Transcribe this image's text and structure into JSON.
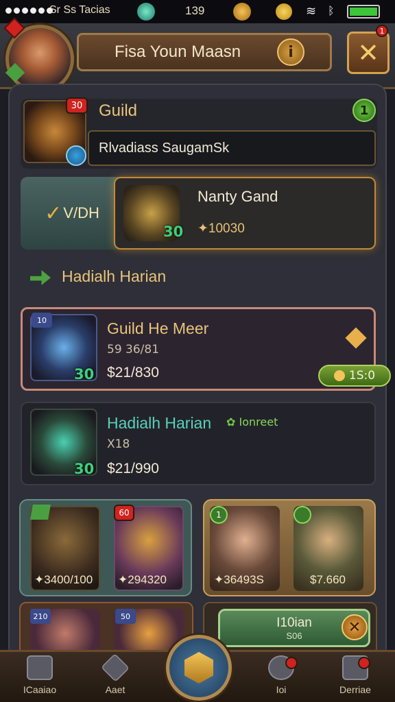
{
  "status": {
    "carrier": "Sr Ss Tacias",
    "gems": "139",
    "colors": {
      "battery": "#3ec43a"
    }
  },
  "header": {
    "title": "Fisa Youn Maasn",
    "avatar_badge": "",
    "close_badge": "1"
  },
  "guild": {
    "label": "Guild",
    "badge": "30",
    "info_badge": "1",
    "name_field": "Rlvadiass SaugamSk"
  },
  "rank": {
    "left_label": "V/DH",
    "name": "Nanty Gand",
    "value": "✦10030",
    "level": "30"
  },
  "section": {
    "title": "Hadialh Harian"
  },
  "items": [
    {
      "title": "Guild He Meer",
      "sub": "59 36/81",
      "price": "$21/830",
      "level": "30",
      "badge": "10",
      "timer": "1S:0"
    },
    {
      "title": "Hadialh Harian",
      "sub": "X18",
      "price": "$21/990",
      "level": "30",
      "tag": "Ionreet"
    }
  ],
  "groupA": {
    "tiles": [
      {
        "price": "✦3400/100"
      },
      {
        "price": "✦294320",
        "badge": "60"
      }
    ]
  },
  "groupB": {
    "tiles": [
      {
        "price": "✦36493S",
        "badge": "1"
      },
      {
        "price": "$7.660",
        "badge": ""
      }
    ]
  },
  "bottom": {
    "tileA1_badge": "210",
    "tileA2_badge": "50",
    "action_label": "I10ian",
    "action_sub": "S06"
  },
  "nav": [
    {
      "label": "ICaaiao"
    },
    {
      "label": "Aaet"
    },
    {
      "label": "Ioi"
    },
    {
      "label": "Derriae"
    }
  ]
}
